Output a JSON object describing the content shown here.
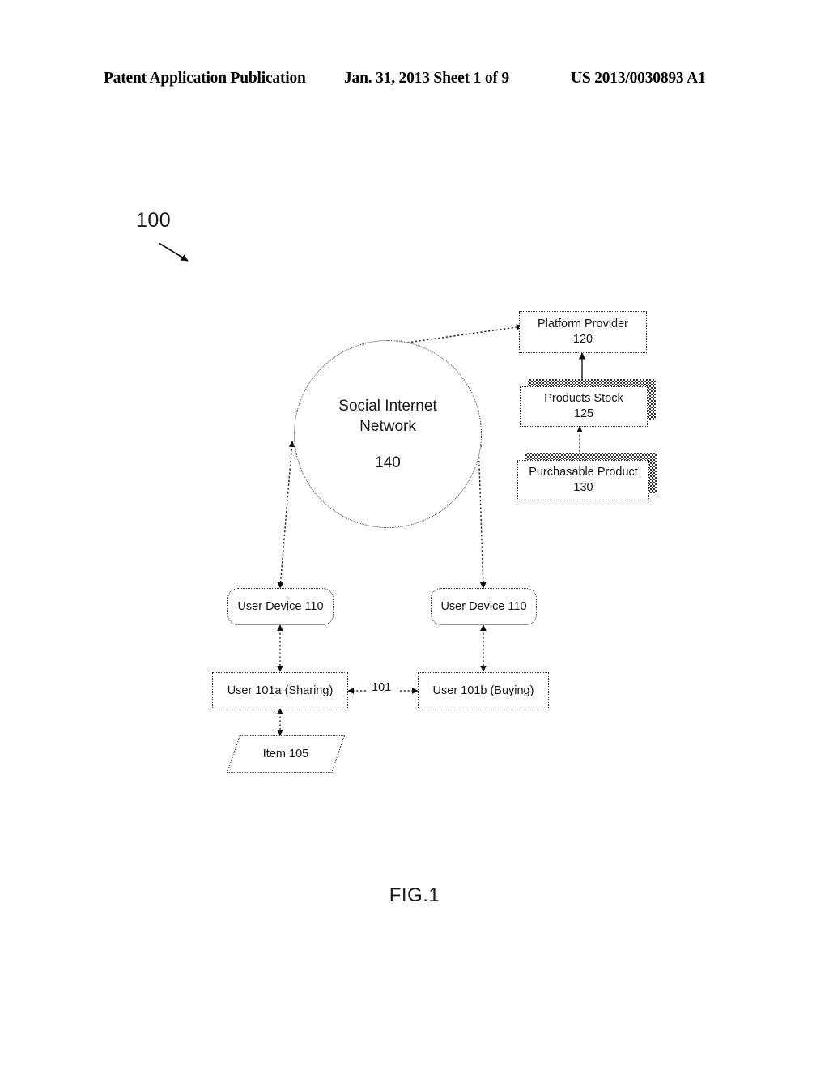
{
  "header": {
    "publication": "Patent Application Publication",
    "date_sheet": "Jan. 31, 2013  Sheet 1 of 9",
    "patent_number": "US 2013/0030893 A1"
  },
  "figure": {
    "caption": "FIG.1",
    "system_ref": "100",
    "relation_ref": "101",
    "nodes": {
      "platform_provider": {
        "title": "Platform Provider",
        "ref": "120"
      },
      "products_stock": {
        "title": "Products Stock",
        "ref": "125"
      },
      "purchasable_product": {
        "title": "Purchasable Product",
        "ref": "130"
      },
      "social_network": {
        "title_line1": "Social Internet",
        "title_line2": "Network",
        "ref": "140"
      },
      "user_device_left": {
        "label": "User Device 110"
      },
      "user_device_right": {
        "label": "User Device 110"
      },
      "user_sharing": {
        "label": "User 101a (Sharing)"
      },
      "user_buying": {
        "label": "User 101b (Buying)"
      },
      "item": {
        "label": "Item 105"
      }
    }
  },
  "colors": {
    "ink": "#151515",
    "line": "#2a2a2a",
    "page": "#ffffff"
  }
}
